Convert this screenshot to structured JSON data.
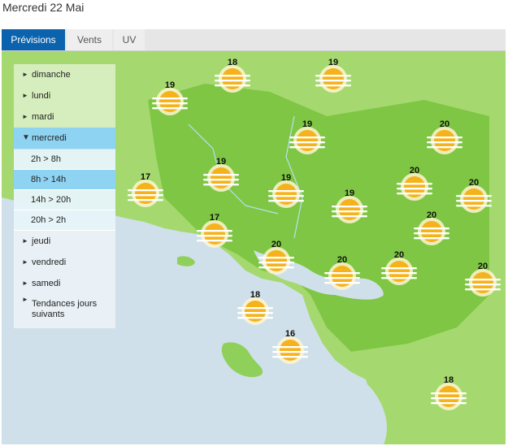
{
  "header": {
    "title": "Mercredi 22 Mai"
  },
  "tabs": [
    {
      "label": "Prévisions",
      "active": true
    },
    {
      "label": "Vents",
      "active": false
    },
    {
      "label": "UV",
      "active": false
    }
  ],
  "menu": {
    "days": {
      "dimanche": "dimanche",
      "lundi": "lundi",
      "mardi": "mardi",
      "mercredi": "mercredi",
      "jeudi": "jeudi",
      "vendredi": "vendredi",
      "samedi": "samedi",
      "tendances": "Tendances jours suivants"
    },
    "slots": [
      "2h > 8h",
      "8h > 14h",
      "14h > 20h",
      "20h > 2h"
    ],
    "selected_slot": "8h > 14h"
  },
  "map": {
    "icon": "sun-haze-icon",
    "colors": {
      "land": "#8fd05a",
      "land_dark": "#79c23f",
      "sea": "#cfe0ea",
      "sun": "#f5b21b",
      "haze": "#fff4cf"
    },
    "temperatures": [
      "18",
      "19",
      "19",
      "19",
      "20",
      "19",
      "17",
      "19",
      "20",
      "19",
      "20",
      "20",
      "17",
      "20",
      "20",
      "20",
      "20",
      "18",
      "16",
      "18"
    ]
  }
}
